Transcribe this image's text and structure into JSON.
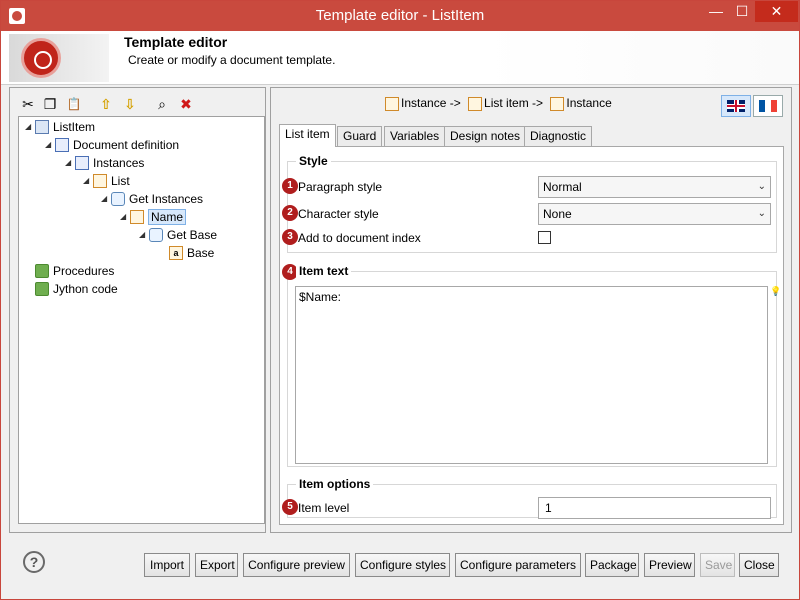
{
  "window": {
    "title": "Template editor - ListItem",
    "minimize_glyph": "—",
    "maximize_glyph": "☐",
    "close_glyph": "✕"
  },
  "banner": {
    "title": "Template editor",
    "subtitle": "Create or modify a document template."
  },
  "toolbar": {
    "icons": [
      "cut-icon",
      "copy-icon",
      "paste-icon",
      "move-up-icon",
      "move-down-icon",
      "find-icon",
      "delete-icon"
    ],
    "glyphs": [
      "✂",
      "❐",
      "📋",
      "⇧",
      "⇩",
      "⌕",
      "✖"
    ],
    "colors": {
      "arrows": "#d4a000",
      "delete": "#d01818"
    }
  },
  "tree": {
    "items": [
      {
        "label": "ListItem",
        "icon": "template-root-icon",
        "toggle": "◢",
        "level": 0
      },
      {
        "label": "Document definition",
        "icon": "document-definition-icon",
        "toggle": "◢",
        "level": 1
      },
      {
        "label": "Instances",
        "icon": "instances-icon",
        "toggle": "◢",
        "level": 2
      },
      {
        "label": "List",
        "icon": "list-icon",
        "toggle": "◢",
        "level": 3
      },
      {
        "label": "Get Instances",
        "icon": "query-icon",
        "toggle": "◢",
        "level": 4
      },
      {
        "label": "Name",
        "icon": "list-item-icon",
        "toggle": "◢",
        "level": 5,
        "selected": true
      },
      {
        "label": "Get Base",
        "icon": "get-attribute-icon",
        "toggle": "◢",
        "level": 6
      },
      {
        "label": "Base",
        "icon": "attribute-icon",
        "icon_glyph": "a",
        "toggle": "",
        "level": 7
      },
      {
        "label": "Procedures",
        "icon": "folder-icon",
        "toggle": "",
        "level": 0
      },
      {
        "label": "Jython code",
        "icon": "folder-icon",
        "toggle": "",
        "level": 0
      }
    ]
  },
  "breadcrumb": {
    "items": [
      "Instance ->",
      "List item ->",
      "Instance"
    ]
  },
  "languages": [
    "uk-flag-icon",
    "france-flag-icon"
  ],
  "tabs": [
    {
      "label": "List item",
      "active": true
    },
    {
      "label": "Guard"
    },
    {
      "label": "Variables"
    },
    {
      "label": "Design notes"
    },
    {
      "label": "Diagnostic"
    }
  ],
  "style_group": {
    "title": "Style",
    "paragraph_style": {
      "badge": "1",
      "label": "Paragraph style",
      "value": "Normal"
    },
    "character_style": {
      "badge": "2",
      "label": "Character style",
      "value": "None"
    },
    "document_index": {
      "badge": "3",
      "label": "Add to document index",
      "checked": false
    }
  },
  "item_text_group": {
    "badge": "4",
    "title": "Item text",
    "value": "$Name:"
  },
  "item_options_group": {
    "title": "Item options",
    "item_level": {
      "badge": "5",
      "label": "Item level",
      "value": "1"
    }
  },
  "buttons": {
    "help_glyph": "?",
    "import": "Import",
    "export": "Export",
    "configure_preview": "Configure preview",
    "configure_styles": "Configure styles",
    "configure_parameters": "Configure parameters",
    "package": "Package",
    "preview": "Preview",
    "save": "Save",
    "close": "Close"
  },
  "colors": {
    "titlebar": "#c94a3e",
    "badge": "#b01e1e",
    "selection": "#d7e8fb"
  }
}
